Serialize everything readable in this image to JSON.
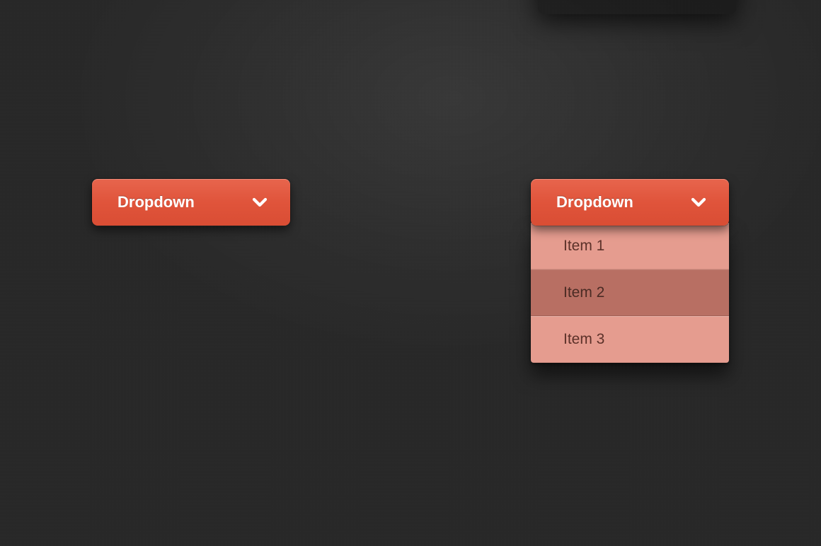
{
  "closed": {
    "label": "Dropdown"
  },
  "open": {
    "label": "Dropdown",
    "items": [
      {
        "label": "Item 1",
        "hover": false
      },
      {
        "label": "Item 2",
        "hover": true
      },
      {
        "label": "Item 3",
        "hover": false
      }
    ]
  },
  "colors": {
    "button_top": "#e7654d",
    "button_bottom": "#d94d34",
    "item_bg": "#e59c8f",
    "item_hover_bg": "#b86f63",
    "item_text": "#5c3129",
    "background": "#262626"
  }
}
